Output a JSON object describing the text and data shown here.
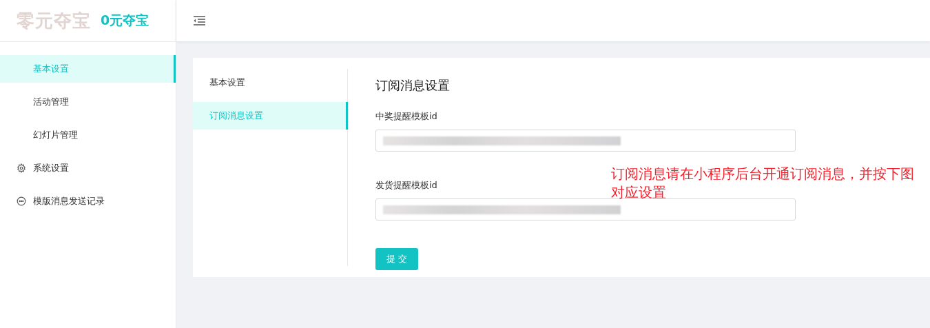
{
  "logo": {
    "image_text": "零元夺宝",
    "title": "0元夺宝"
  },
  "sidebar": {
    "items": [
      {
        "label": "基本设置",
        "kind": "subitem",
        "selected": true
      },
      {
        "label": "活动管理",
        "kind": "subitem",
        "selected": false
      },
      {
        "label": "幻灯片管理",
        "kind": "subitem",
        "selected": false
      },
      {
        "label": "系统设置",
        "kind": "settings",
        "selected": false
      },
      {
        "label": "模版消息发送记录",
        "kind": "messages",
        "selected": false
      }
    ]
  },
  "settings_tabs": [
    {
      "label": "基本设置",
      "selected": false
    },
    {
      "label": "订阅消息设置",
      "selected": true
    }
  ],
  "form": {
    "title": "订阅消息设置",
    "fields": [
      {
        "label": "中奖提醒模板id",
        "redacted": true
      },
      {
        "label": "发货提醒模板id",
        "redacted": true
      }
    ],
    "submit": "提 交",
    "note": "订阅消息请在小程序后台开通订阅消息，并按下图对应设置"
  }
}
